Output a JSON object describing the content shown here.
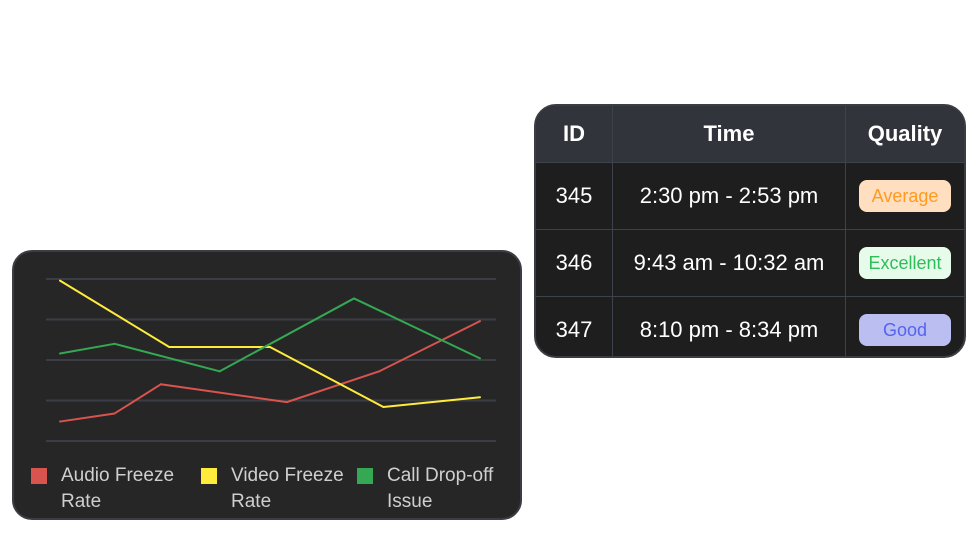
{
  "chart_data": {
    "type": "line",
    "title": "",
    "xlabel": "",
    "ylabel": "",
    "ylim": [
      0,
      100
    ],
    "xlim": [
      0,
      100
    ],
    "grid": true,
    "gridlines_y": [
      0,
      25,
      50,
      75,
      100
    ],
    "legend_position": "bottom",
    "series": [
      {
        "name": "Audio Freeze Rate",
        "color": "#d9534f",
        "x": [
          0,
          13,
          24,
          54,
          76,
          100
        ],
        "y": [
          12,
          17,
          35,
          24,
          43,
          74
        ]
      },
      {
        "name": "Video Freeze Rate",
        "color": "#ffeb3b",
        "x": [
          0,
          26,
          50,
          77,
          100
        ],
        "y": [
          99,
          58,
          58,
          21,
          27
        ]
      },
      {
        "name": "Call Drop-off Issue",
        "color": "#34a853",
        "x": [
          0,
          13,
          38,
          70,
          100
        ],
        "y": [
          54,
          60,
          43,
          88,
          51
        ]
      }
    ]
  },
  "legend": [
    {
      "label_line1": "Audio Freeze",
      "label_line2": "Rate",
      "color": "#d9534f"
    },
    {
      "label_line1": "Video Freeze",
      "label_line2": "Rate",
      "color": "#ffeb3b"
    },
    {
      "label_line1": "Call Drop-off",
      "label_line2": "Issue",
      "color": "#34a853"
    }
  ],
  "table": {
    "headers": {
      "id": "ID",
      "time": "Time",
      "quality": "Quality"
    },
    "rows": [
      {
        "id": "345",
        "time": "2:30 pm - 2:53 pm",
        "quality": "Average"
      },
      {
        "id": "346",
        "time": "9:43 am - 10:32 am",
        "quality": "Excellent"
      },
      {
        "id": "347",
        "time": "8:10 pm - 8:34 pm",
        "quality": "Good"
      }
    ]
  },
  "badge_colors": {
    "Average": {
      "bg": "#ffdfbf",
      "fg": "#ff9a1f"
    },
    "Excellent": {
      "bg": "#e6fbea",
      "fg": "#2ebd59"
    },
    "Good": {
      "bg": "#babef0",
      "fg": "#5563f0"
    }
  }
}
